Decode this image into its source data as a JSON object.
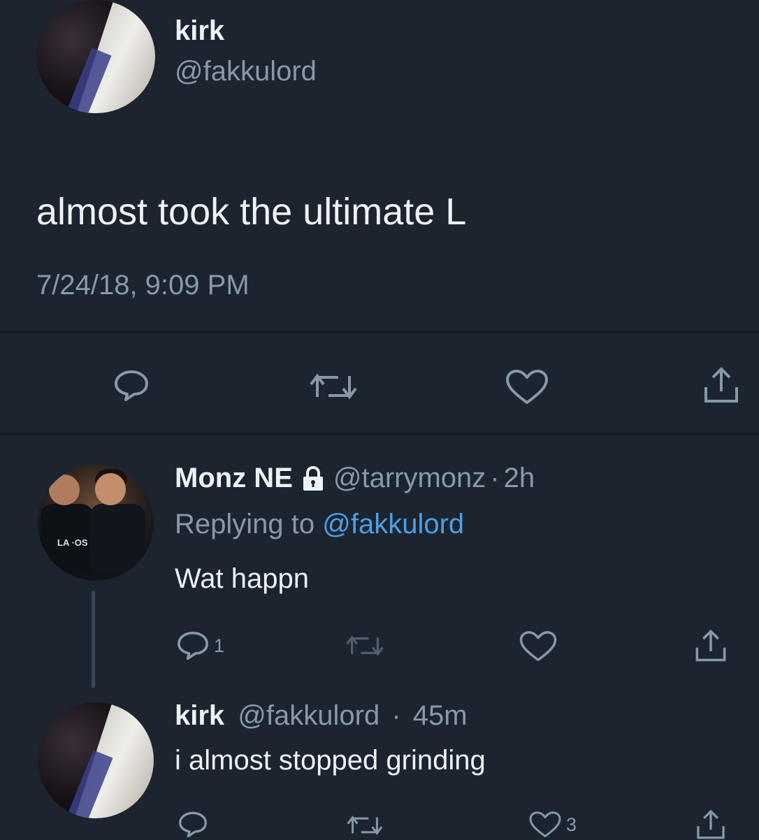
{
  "main_tweet": {
    "display_name": "kirk",
    "handle": "@fakkulord",
    "text": "almost took the ultimate L",
    "timestamp": "7/24/18, 9:09 PM",
    "actions": [
      "reply-icon",
      "retweet-icon",
      "like-icon",
      "share-icon"
    ]
  },
  "reply_1": {
    "display_name": "Monz NE",
    "handle": "@tarrymonz",
    "separator": "·",
    "time": "2h",
    "replying_prefix": "Replying to",
    "replying_handle": "@fakkulord",
    "text": "Wat happn",
    "reply_count": "1",
    "icons": [
      "lock-icon",
      "reply-icon",
      "retweet-icon",
      "like-icon",
      "share-icon"
    ]
  },
  "reply_2": {
    "display_name": "kirk",
    "handle": "@fakkulord",
    "separator": "·",
    "time": "45m",
    "text": "i almost stopped grinding",
    "like_count": "3"
  },
  "colors": {
    "background": "#1c2430",
    "text": "#e6eaee",
    "muted": "#8899a6",
    "link": "#4aa0e6",
    "divider": "#121820"
  }
}
